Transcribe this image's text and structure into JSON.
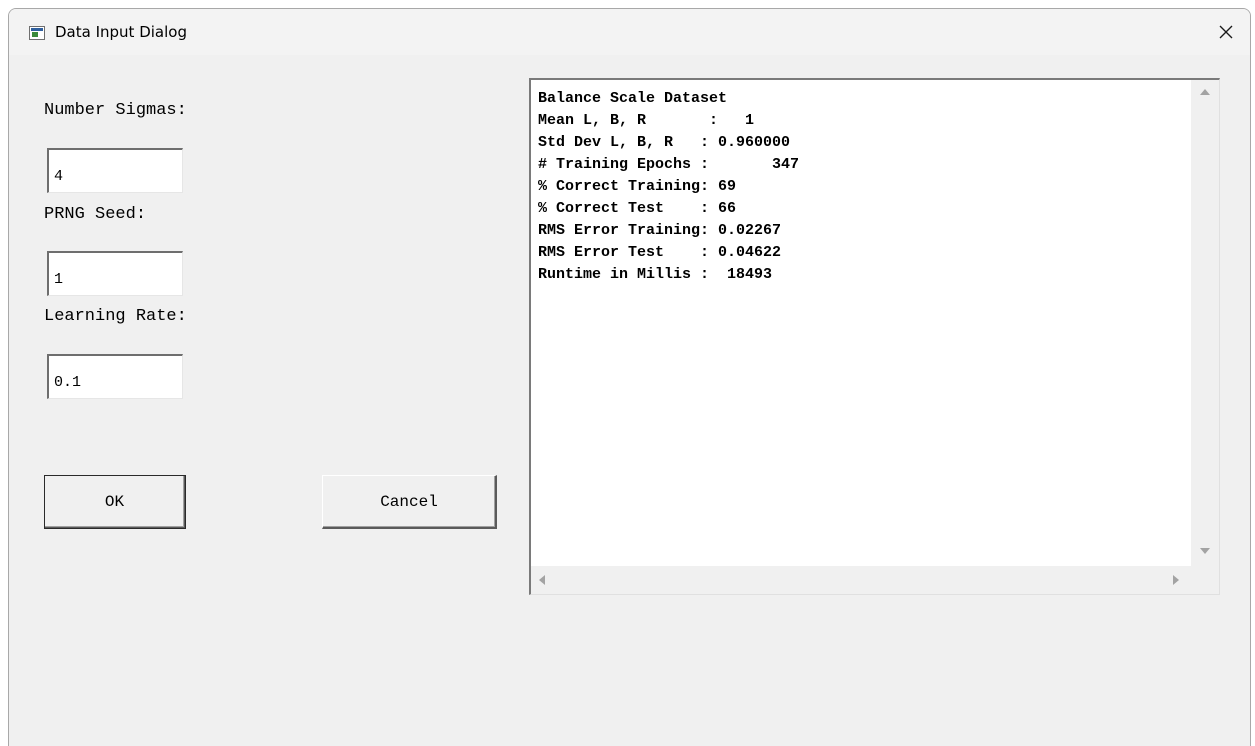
{
  "window": {
    "title": "Data Input Dialog",
    "app_icon": "app-window-icon",
    "close_icon": "close-icon"
  },
  "form": {
    "number_sigmas_label": "Number Sigmas:",
    "number_sigmas_value": "4",
    "prng_seed_label": "PRNG Seed:",
    "prng_seed_value": "1",
    "learning_rate_label": "Learning Rate:",
    "learning_rate_value": "0.1"
  },
  "buttons": {
    "ok_label": "OK",
    "cancel_label": "Cancel"
  },
  "output": {
    "lines": [
      "Balance Scale Dataset",
      "Mean L, B, R       :   1",
      "Std Dev L, B, R   : 0.960000",
      "# Training Epochs :       347",
      "% Correct Training: 69",
      "% Correct Test    : 66",
      "RMS Error Training: 0.02267",
      "RMS Error Test    : 0.04622",
      "Runtime in Millis :  18493"
    ],
    "scroll_icons": [
      "scroll-up-icon",
      "scroll-down-icon",
      "scroll-left-icon",
      "scroll-right-icon"
    ]
  }
}
